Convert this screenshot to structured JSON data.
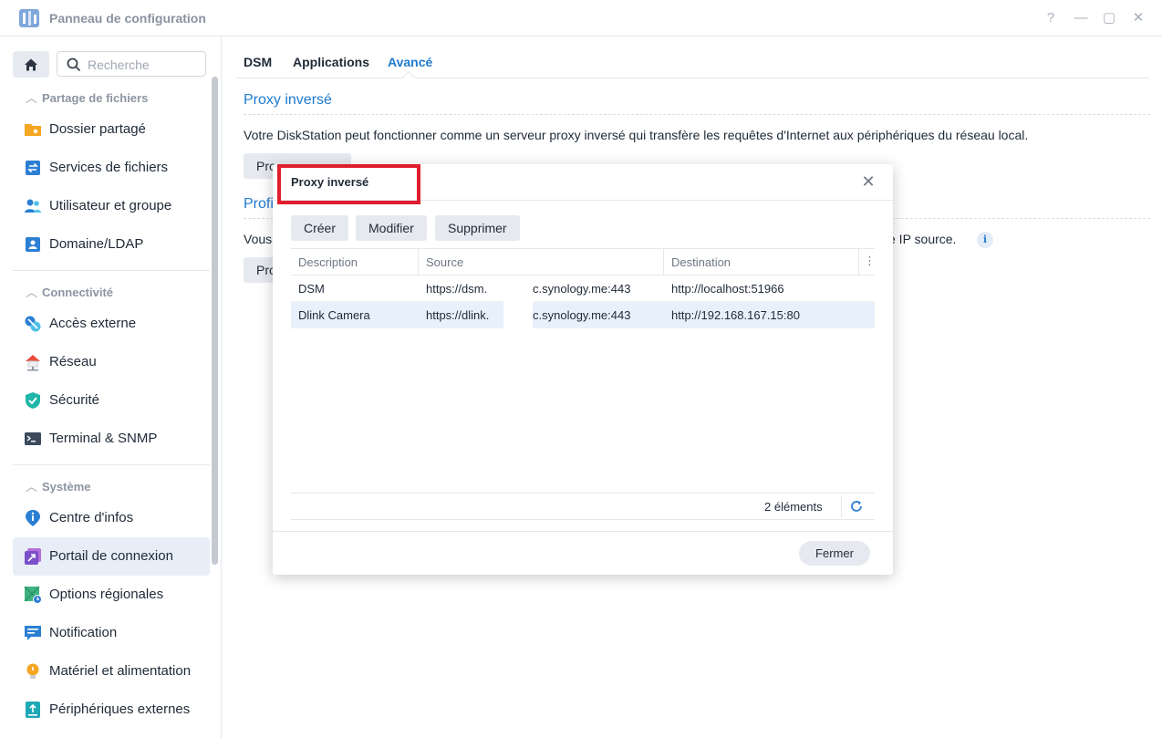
{
  "window": {
    "title": "Panneau de configuration",
    "controls": {
      "help": "?",
      "minimize": "—",
      "maximize": "▢",
      "close": "✕"
    }
  },
  "sidebar": {
    "search_placeholder": "Recherche",
    "sections": [
      {
        "title": "Partage de fichiers",
        "items": [
          {
            "label": "Dossier partagé",
            "icon": "shared-folder-icon"
          },
          {
            "label": "Services de fichiers",
            "icon": "file-services-icon"
          },
          {
            "label": "Utilisateur et groupe",
            "icon": "user-group-icon"
          },
          {
            "label": "Domaine/LDAP",
            "icon": "domain-ldap-icon"
          }
        ]
      },
      {
        "title": "Connectivité",
        "items": [
          {
            "label": "Accès externe",
            "icon": "external-access-icon"
          },
          {
            "label": "Réseau",
            "icon": "network-icon"
          },
          {
            "label": "Sécurité",
            "icon": "security-shield-icon"
          },
          {
            "label": "Terminal & SNMP",
            "icon": "terminal-icon"
          }
        ]
      },
      {
        "title": "Système",
        "items": [
          {
            "label": "Centre d'infos",
            "icon": "info-center-icon"
          },
          {
            "label": "Portail de connexion",
            "icon": "login-portal-icon",
            "active": true
          },
          {
            "label": "Options régionales",
            "icon": "regional-options-icon"
          },
          {
            "label": "Notification",
            "icon": "notification-icon"
          },
          {
            "label": "Matériel et alimentation",
            "icon": "hardware-power-icon"
          },
          {
            "label": "Périphériques externes",
            "icon": "external-devices-icon"
          }
        ]
      }
    ]
  },
  "main": {
    "tabs": [
      "DSM",
      "Applications",
      "Avancé"
    ],
    "active_tab": "Avancé",
    "section1": {
      "title": "Proxy inversé",
      "description": "Votre DiskStation peut fonctionner comme un serveur proxy inversé qui transfère les requêtes d'Internet aux périphériques du réseau local.",
      "button": "Pro"
    },
    "section2": {
      "title_visible": "Profi",
      "text_left": "Vous",
      "text_right": "se IP source.",
      "button": "Pro"
    }
  },
  "modal": {
    "title": "Proxy inversé",
    "toolbar": {
      "create": "Créer",
      "modify": "Modifier",
      "delete": "Supprimer"
    },
    "columns": [
      "Description",
      "Source",
      "Destination"
    ],
    "rows": [
      {
        "description": "DSM",
        "source_a": "https://dsm.",
        "source_b": "c.synology.me:443",
        "destination": "http://localhost:51966"
      },
      {
        "description": "Dlink Camera",
        "source_a": "https://dlink.",
        "source_b": "c.synology.me:443",
        "destination": "http://192.168.167.15:80"
      }
    ],
    "count": "2 éléments",
    "close_button": "Fermer"
  },
  "colors": {
    "accent": "#1f7ad0",
    "highlight_box": "#e01e2e",
    "selected_row": "#e8f1fb"
  }
}
